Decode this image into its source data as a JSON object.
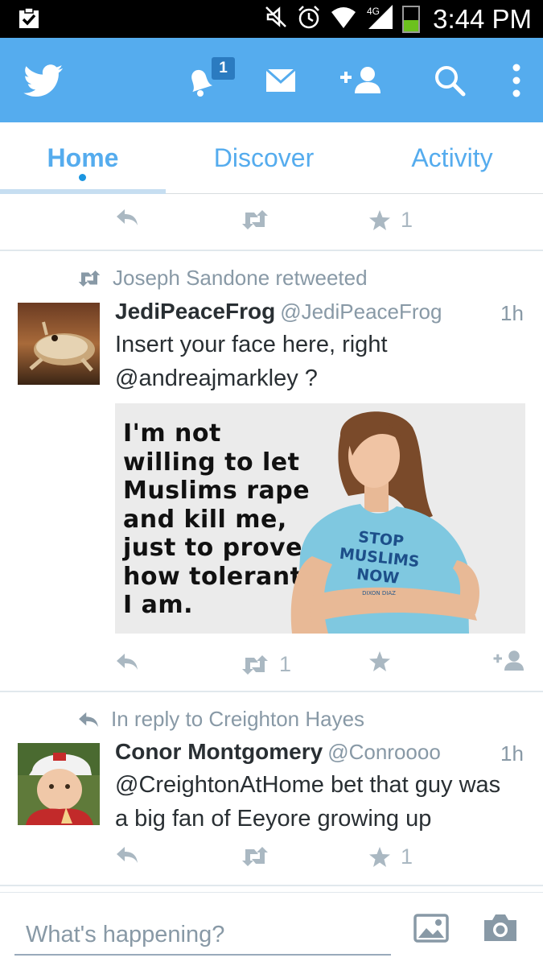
{
  "status_bar": {
    "time": "3:44 PM"
  },
  "app_bar": {
    "notification_count": "1"
  },
  "tabs": [
    {
      "label": "Home"
    },
    {
      "label": "Discover"
    },
    {
      "label": "Activity"
    }
  ],
  "tweets": [
    {
      "actions": {
        "retweet_count": "",
        "favorite_count": "1"
      }
    },
    {
      "context": "Joseph Sandone retweeted",
      "name": "JediPeaceFrog",
      "handle": "@JediPeaceFrog",
      "time": "1h",
      "text_line1": "Insert your face here, right",
      "text_line2": "@andreajmarkley ?",
      "media": {
        "text_lines": [
          "I'm not",
          "willing to let",
          "Muslims rape",
          "and kill me,",
          "just to prove",
          "how tolerant",
          "I am."
        ],
        "shirt_lines": [
          "STOP",
          "MUSLIMS",
          "NOW"
        ],
        "watermark": "DIXON DIAZ"
      },
      "actions": {
        "retweet_count": "1",
        "favorite_count": ""
      }
    },
    {
      "context": "In reply to Creighton Hayes",
      "name": "Conor Montgomery",
      "handle": "@Conroooo",
      "time": "1h",
      "text_line1": "@CreightonAtHome bet that guy was",
      "text_line2": "a big fan of Eeyore growing up",
      "actions": {
        "retweet_count": "",
        "favorite_count": "1"
      }
    }
  ],
  "compose": {
    "placeholder": "What's happening?"
  },
  "colors": {
    "brand": "#55acee",
    "muted": "#8899a6",
    "action_icon": "#aab8c2"
  }
}
